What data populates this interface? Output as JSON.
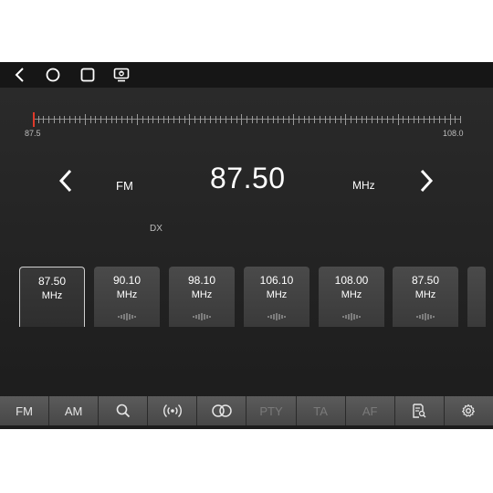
{
  "nav": {
    "icons": [
      "back-icon",
      "home-icon",
      "recents-icon",
      "screen-icon"
    ]
  },
  "scale": {
    "min_label": "87.5",
    "max_label": "108.0",
    "min": 87.5,
    "max": 108.0,
    "current": 87.5
  },
  "tuner": {
    "band": "FM",
    "frequency": "87.50",
    "unit": "MHz",
    "dx": "DX"
  },
  "presets": [
    {
      "freq": "87.50",
      "unit": "MHz",
      "active": true
    },
    {
      "freq": "90.10",
      "unit": "MHz",
      "active": false
    },
    {
      "freq": "98.10",
      "unit": "MHz",
      "active": false
    },
    {
      "freq": "106.10",
      "unit": "MHz",
      "active": false
    },
    {
      "freq": "108.00",
      "unit": "MHz",
      "active": false
    },
    {
      "freq": "87.50",
      "unit": "MHz",
      "active": false
    }
  ],
  "tabs": [
    {
      "label": "FM",
      "icon": null,
      "enabled": true
    },
    {
      "label": "AM",
      "icon": null,
      "enabled": true
    },
    {
      "label": "",
      "icon": "search-icon",
      "enabled": true
    },
    {
      "label": "",
      "icon": "broadcast-icon",
      "enabled": true
    },
    {
      "label": "",
      "icon": "stereo-icon",
      "enabled": true
    },
    {
      "label": "PTY",
      "icon": null,
      "enabled": false
    },
    {
      "label": "TA",
      "icon": null,
      "enabled": false
    },
    {
      "label": "AF",
      "icon": null,
      "enabled": false
    },
    {
      "label": "",
      "icon": "station-list-icon",
      "enabled": true
    },
    {
      "label": "",
      "icon": "settings-icon",
      "enabled": true
    }
  ],
  "colors": {
    "needle": "#e03a2a",
    "wave_active_start": "#4f8ee8",
    "wave_active_end": "#c04fd8"
  }
}
